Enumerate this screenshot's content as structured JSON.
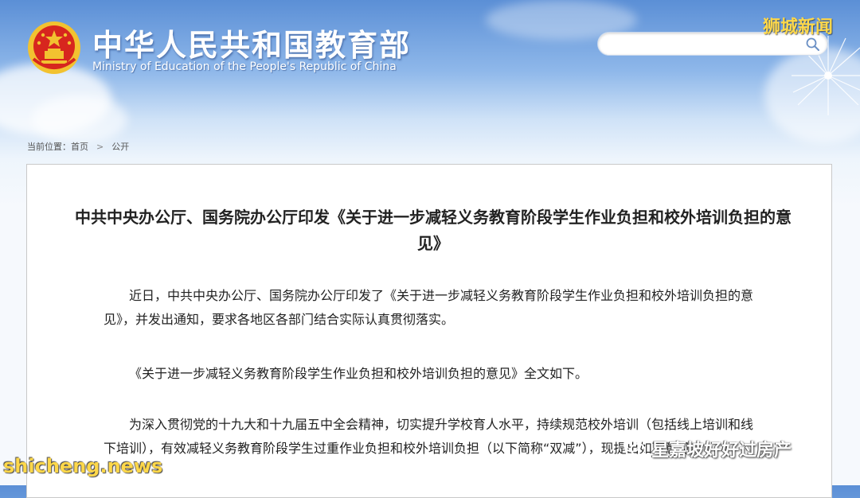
{
  "header": {
    "site_title": "中华人民共和国教育部",
    "site_subtitle": "Ministry of Education of the People's Republic of China",
    "emblem_icon": "national-emblem-icon"
  },
  "search": {
    "placeholder": "",
    "value": "",
    "icon": "search-icon"
  },
  "breadcrumb": {
    "prefix": "当前位置：",
    "home": "首页",
    "separator": ">",
    "current": "公开"
  },
  "article": {
    "title": "中共中央办公厅、国务院办公厅印发《关于进一步减轻义务教育阶段学生作业负担和校外培训负担的意见》",
    "paragraphs": [
      "近日，中共中央办公厅、国务院办公厅印发了《关于进一步减轻义务教育阶段学生作业负担和校外培训负担的意见》，并发出通知，要求各地区各部门结合实际认真贯彻落实。",
      "《关于进一步减轻义务教育阶段学生作业负担和校外培训负担的意见》全文如下。",
      "为深入贯彻党的十九大和十九届五中全会精神，切实提升学校育人水平，持续规范校外培训（包括线上培训和线下培训），有效减轻义务教育阶段学生过重作业负担和校外培训负担（以下简称“双减”），现提出如下意见。"
    ]
  },
  "watermarks": {
    "top_right": "狮城新闻",
    "bottom_left": "shicheng.news",
    "bottom_right": "星嘉坡好好过房产",
    "bottom_right_icon": "wechat-icon"
  },
  "colors": {
    "header_blue": "#5b8fd6",
    "watermark_yellow": "#ffd84a",
    "emblem_red": "#d7261e",
    "emblem_gold": "#f2c230"
  }
}
